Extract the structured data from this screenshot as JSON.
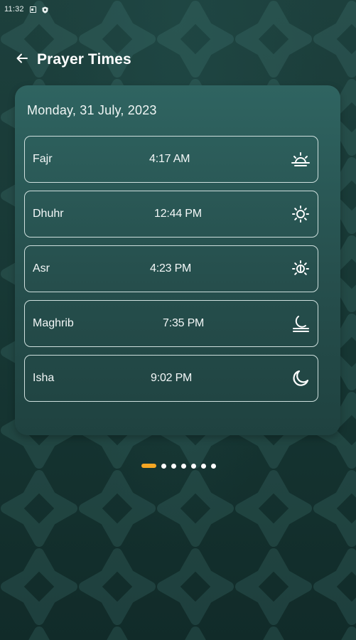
{
  "status_bar": {
    "time": "11:32",
    "icons": [
      "sim-icon",
      "shield-icon"
    ]
  },
  "header": {
    "back_icon": "arrow-left-icon",
    "title": "Prayer Times"
  },
  "card": {
    "date": "Monday, 31 July, 2023",
    "prayers": [
      {
        "name": "Fajr",
        "time": "4:17 AM",
        "icon": "sunrise-icon"
      },
      {
        "name": "Dhuhr",
        "time": "12:44 PM",
        "icon": "sun-icon"
      },
      {
        "name": "Asr",
        "time": "4:23 PM",
        "icon": "afternoon-sun-icon"
      },
      {
        "name": "Maghrib",
        "time": "7:35 PM",
        "icon": "sunset-moon-icon"
      },
      {
        "name": "Isha",
        "time": "9:02 PM",
        "icon": "crescent-moon-icon"
      }
    ]
  },
  "pager": {
    "count": 7,
    "active_index": 0
  },
  "colors": {
    "background": "#14302e",
    "card": "#2f6461",
    "accent": "#f5a623",
    "text": "#ffffff"
  }
}
